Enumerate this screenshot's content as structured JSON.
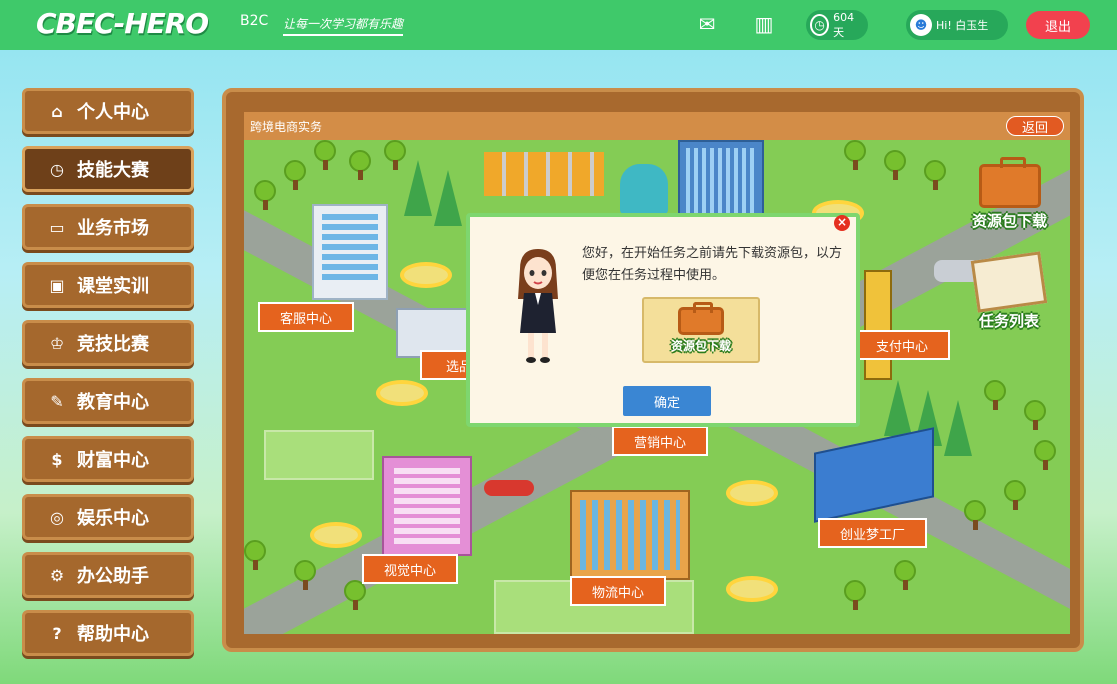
{
  "header": {
    "brand": "CBEC-HERO",
    "brand_sub": "B2C",
    "slogan": "让每一次学习都有乐趣",
    "days": "604天",
    "user_greeting": "Hi! 白玉生",
    "logout_label": "退出"
  },
  "menu": {
    "items": [
      {
        "label": "个人中心",
        "icon": "home-icon"
      },
      {
        "label": "技能大赛",
        "icon": "clock-icon"
      },
      {
        "label": "业务市场",
        "icon": "briefcase-icon"
      },
      {
        "label": "课堂实训",
        "icon": "book-icon"
      },
      {
        "label": "竞技比赛",
        "icon": "trophy-icon"
      },
      {
        "label": "教育中心",
        "icon": "pencil-icon"
      },
      {
        "label": "财富中心",
        "icon": "money-bag-icon"
      },
      {
        "label": "娱乐中心",
        "icon": "gamepad-icon"
      },
      {
        "label": "办公助手",
        "icon": "tools-icon"
      },
      {
        "label": "帮助中心",
        "icon": "help-icon"
      }
    ],
    "active_index": 1
  },
  "panel": {
    "title": "跨境电商实务",
    "back_label": "返回"
  },
  "map": {
    "resource_download": "资源包下载",
    "task_list": "任务列表",
    "locations": {
      "customer_service": "客服中心",
      "selection": "选品",
      "payment": "支付中心",
      "marketing": "营销中心",
      "visual": "视觉中心",
      "logistics": "物流中心",
      "startup": "创业梦工厂"
    }
  },
  "modal": {
    "message": "您好，在开始任务之前请先下载资源包，以方便您在任务过程中使用。",
    "download_label": "资源包下载",
    "confirm_label": "确定"
  },
  "colors": {
    "topbar": "#3fc96a",
    "menu_bg": "#a5682d",
    "label_orange": "#e5631e",
    "logout_red": "#f2414e",
    "confirm_blue": "#3a86d3"
  }
}
